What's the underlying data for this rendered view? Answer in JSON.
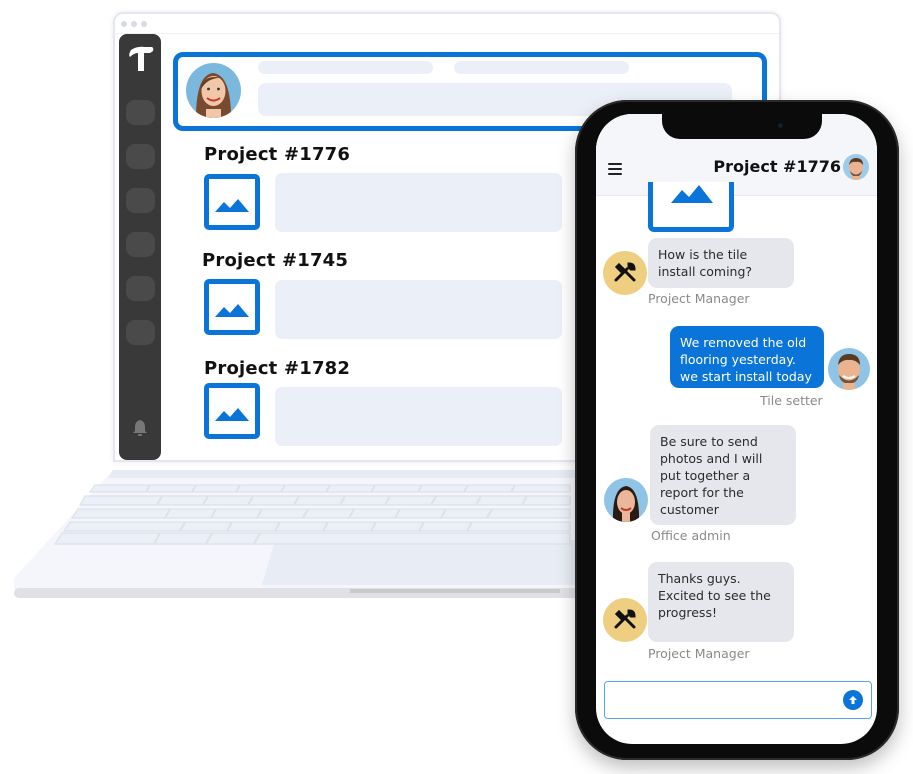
{
  "laptop": {
    "window_controls": [
      "close",
      "minimize",
      "maximize"
    ],
    "sidebar": {
      "logo_icon": "hammer-icon",
      "nav_slot_count": 6,
      "bottom_icon": "bell-icon"
    },
    "header_card": {
      "avatar": "woman-avatar"
    },
    "projects": [
      {
        "title": "Project  #1776",
        "thumb_icon": "image-icon"
      },
      {
        "title": "Project  #1745",
        "thumb_icon": "image-icon"
      },
      {
        "title": "Project  #1782",
        "thumb_icon": "image-icon"
      }
    ]
  },
  "phone": {
    "header": {
      "menu_icon": "hamburger-menu-icon",
      "title": "Project #1776",
      "avatar": "man-avatar"
    },
    "messages": [
      {
        "direction": "in",
        "sender": "Project Manager",
        "avatar": "tools-icon",
        "text": "How is the tile install coming?"
      },
      {
        "direction": "out",
        "sender": "Tile setter",
        "avatar": "man-avatar",
        "text": "We removed the old flooring yesterday. we start install today"
      },
      {
        "direction": "in",
        "sender": "Office admin",
        "avatar": "woman-avatar",
        "text": "Be sure to send photos and I will put together a report for the customer"
      },
      {
        "direction": "in",
        "sender": "Project Manager",
        "avatar": "tools-icon",
        "text": "Thanks guys. Excited to see the progress!"
      }
    ],
    "composer": {
      "value": "",
      "placeholder": "",
      "send_icon": "arrow-up-icon"
    }
  },
  "colors": {
    "accent": "#0a74d8",
    "sidebar": "#393939",
    "skeleton": "#ebeff7",
    "incoming_bubble": "#e6e7ec",
    "pm_avatar": "#eecf82"
  }
}
